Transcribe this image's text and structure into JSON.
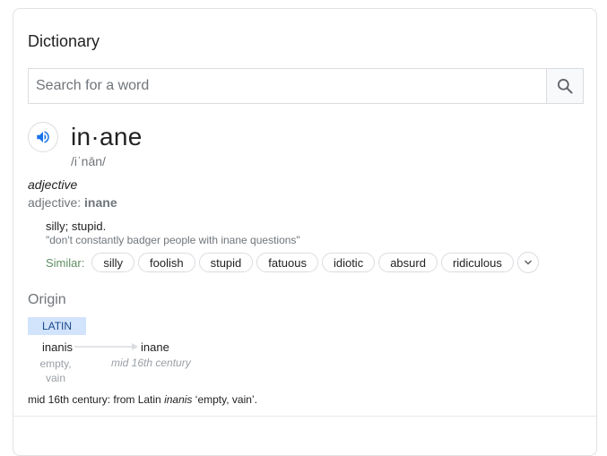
{
  "panel": {
    "title": "Dictionary"
  },
  "search": {
    "placeholder": "Search for a word",
    "value": "",
    "icon": "search-icon"
  },
  "entry": {
    "headword": "in·ane",
    "phonetic": "/iˈnān/",
    "speaker_icon": "speaker-icon",
    "part_of_speech": "adjective",
    "forms_label": "adjective:",
    "forms_value": "inane",
    "definition": "silly; stupid.",
    "example": "\"don't constantly badger people with inane questions\"",
    "similar_label": "Similar:",
    "similar": [
      "silly",
      "foolish",
      "stupid",
      "fatuous",
      "idiotic",
      "absurd",
      "ridiculous"
    ],
    "expand_icon": "chevron-down-icon"
  },
  "origin": {
    "title": "Origin",
    "language": "LATIN",
    "source_word": "inanis",
    "source_gloss": "empty, vain",
    "target_word": "inane",
    "target_date": "mid 16th century",
    "text_prefix": "mid 16th century: from Latin ",
    "text_italic": "inanis",
    "text_suffix": " ‘empty, vain’."
  },
  "colors": {
    "accent_blue": "#1a73e8",
    "tag_bg": "#d2e3fc",
    "similar_label": "#5f8f64"
  }
}
